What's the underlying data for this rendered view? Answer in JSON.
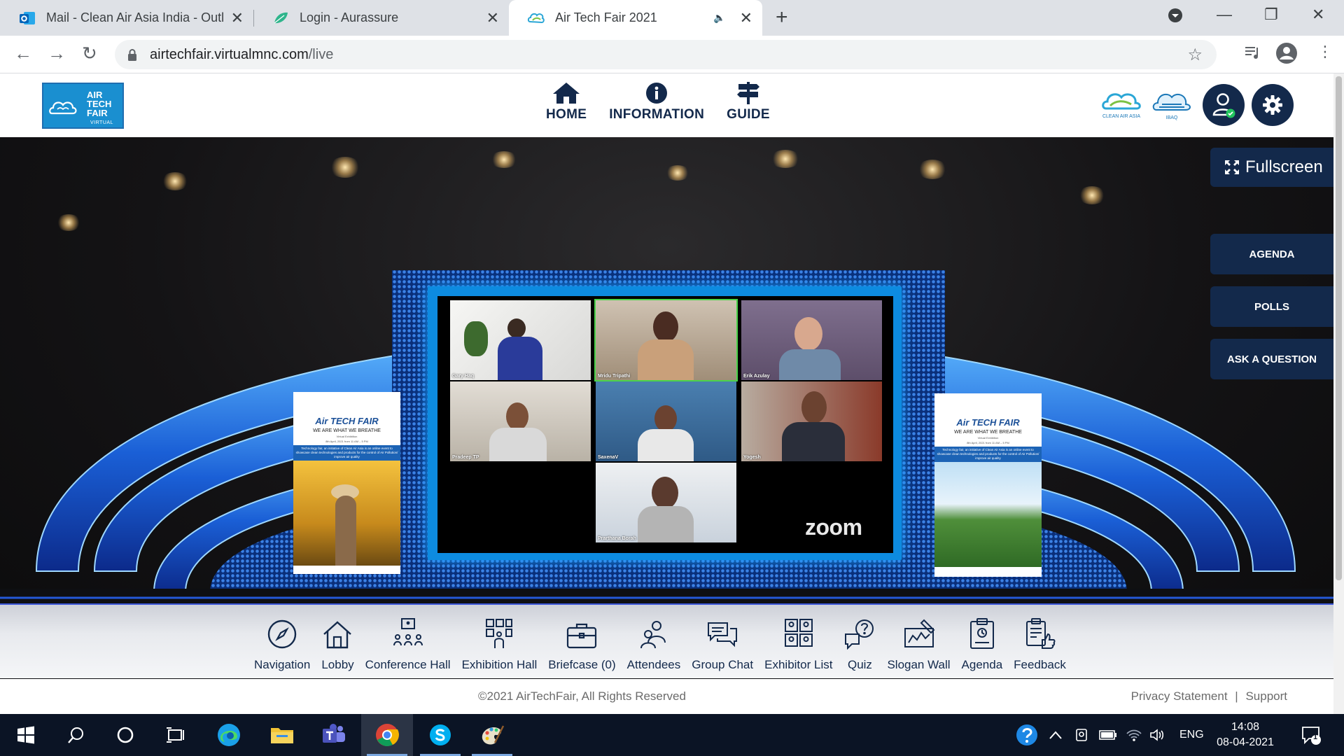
{
  "browser": {
    "tabs": [
      {
        "title": "Mail - Clean Air Asia India - Outlo",
        "icon": "outlook-icon"
      },
      {
        "title": "Login - Aurassure",
        "icon": "aurassure-leaf-icon"
      },
      {
        "title": "Air Tech Fair 2021",
        "icon": "airtechfair-cloud-icon",
        "active": true
      }
    ],
    "url_domain": "airtechfair.virtualmnc.com",
    "url_path": "/live"
  },
  "site": {
    "logo": {
      "line1": "AIR",
      "line2": "TECH",
      "line3": "FAIR",
      "line4": "VIRTUAL"
    },
    "nav": [
      {
        "label": "HOME",
        "icon": "home-icon"
      },
      {
        "label": "INFORMATION",
        "icon": "info-icon"
      },
      {
        "label": "GUIDE",
        "icon": "signpost-icon"
      }
    ],
    "partners": [
      "CLEAN AIR ASIA",
      "IBAQ"
    ],
    "accent": "#13294b"
  },
  "stage": {
    "fullscreen_label": "Fullscreen",
    "side_buttons": [
      "AGENDA",
      "POLLS",
      "ASK A QUESTION"
    ],
    "zoom_brand": "zoom",
    "participants": [
      "Gary Haq",
      "Mridu Tripathi",
      "Erik Azulay",
      "Pradeep TP",
      "SaxenaV",
      "Yogesh",
      "Prarthana Borah"
    ],
    "banner": {
      "title": "Air TECH FAIR",
      "subtitle": "WE ARE WHAT WE BREATHE",
      "sub2": "Virtual Exhibition",
      "date": "8th April, 2021 from 11 AM – 5 PM",
      "blurb": "Technology fair, an initiative of Clean Air Asia is an online event to showcase clean technologies and products for the control of Air Pollution/ improve air quality"
    }
  },
  "bottom_nav": [
    {
      "label": "Navigation",
      "icon": "compass-icon"
    },
    {
      "label": "Lobby",
      "icon": "house-icon"
    },
    {
      "label": "Conference Hall",
      "icon": "conference-hall-icon"
    },
    {
      "label": "Exhibition Hall",
      "icon": "exhibition-hall-icon"
    },
    {
      "label": "Briefcase (0)",
      "icon": "briefcase-icon"
    },
    {
      "label": "Attendees",
      "icon": "attendees-icon"
    },
    {
      "label": "Group Chat",
      "icon": "group-chat-icon"
    },
    {
      "label": "Exhibitor List",
      "icon": "exhibitor-list-icon"
    },
    {
      "label": "Quiz",
      "icon": "quiz-icon"
    },
    {
      "label": "Slogan Wall",
      "icon": "slogan-wall-icon"
    },
    {
      "label": "Agenda",
      "icon": "agenda-clipboard-icon"
    },
    {
      "label": "Feedback",
      "icon": "feedback-icon"
    }
  ],
  "footer": {
    "copyright": "©2021 AirTechFair, All Rights Reserved",
    "privacy": "Privacy Statement",
    "support": "Support",
    "separator": "|"
  },
  "taskbar": {
    "language": "ENG",
    "time": "14:08",
    "date": "08-04-2021",
    "notifications": "1"
  }
}
